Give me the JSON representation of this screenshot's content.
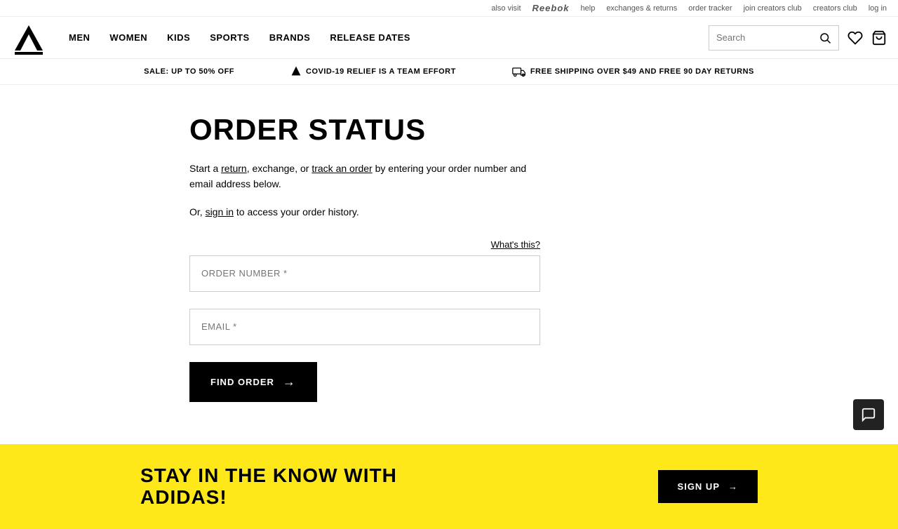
{
  "topbar": {
    "also_visit": "also visit",
    "reebok": "Reebok",
    "help": "help",
    "exchanges_returns": "exchanges & returns",
    "order_tracker": "order tracker",
    "join_creators_club": "join creators club",
    "creators_club": "creators club",
    "log_in": "log in"
  },
  "nav": {
    "men": "MEN",
    "women": "WOMEN",
    "kids": "KIDS",
    "sports": "SPORTS",
    "brands": "BRANDS",
    "release_dates": "RELEASE DATES",
    "search_placeholder": "Search"
  },
  "promo": {
    "sale": "SALE: UP TO 50% OFF",
    "covid": "COVID-19 RELIEF IS A TEAM EFFORT",
    "shipping": "FREE SHIPPING OVER $49 AND FREE 90 DAY RETURNS"
  },
  "page": {
    "title": "ORDER STATUS",
    "intro": "Start a ",
    "return_link": "return",
    "intro2": ", exchange, or ",
    "track_link": "track an order",
    "intro3": " by entering your order number and email address below.",
    "sign_in_pre": "Or, ",
    "sign_in_link": "sign in",
    "sign_in_post": " to access your order history.",
    "what_this": "What's this?",
    "order_number_placeholder": "ORDER NUMBER *",
    "email_placeholder": "EMAIL *",
    "find_order_label": "FIND ORDER"
  },
  "footer_promo": {
    "text_line1": "STAY IN THE KNOW WITH",
    "text_line2": "ADIDAS!",
    "signup_label": "SIGN UP"
  }
}
